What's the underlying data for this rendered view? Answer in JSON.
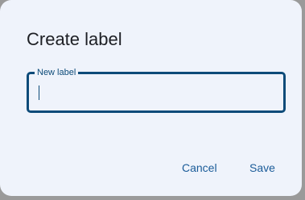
{
  "dialog": {
    "title": "Create label",
    "field_label": "New label",
    "field_value": "",
    "cancel_label": "Cancel",
    "save_label": "Save"
  },
  "colors": {
    "dialog_bg": "#eff3fb",
    "accent": "#0d4b79",
    "button_text": "#1b5c99"
  }
}
